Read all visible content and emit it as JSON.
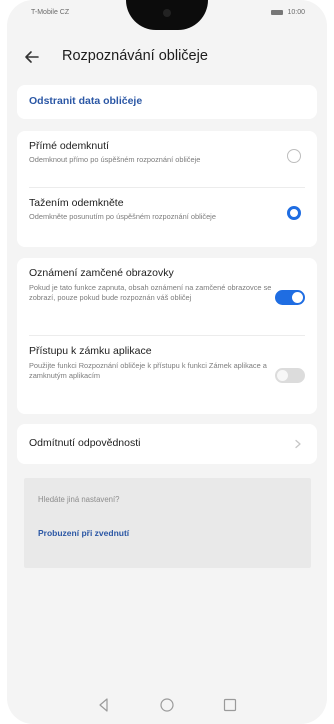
{
  "status": {
    "carrier": "T-Mobile CZ",
    "time": "10:00"
  },
  "header": {
    "title": "Rozpoznávání obličeje"
  },
  "remove_data": {
    "label": "Odstranit data obličeje"
  },
  "unlock_options": [
    {
      "title": "Přímé odemknutí",
      "desc": "Odemknout přímo po úspěšném rozpoznání obličeje",
      "selected": false
    },
    {
      "title": "Tažením odemkněte",
      "desc": "Odemkněte posunutím po úspěšném rozpoznání obličeje",
      "selected": true
    }
  ],
  "lock_screen_notifications": {
    "title": "Oznámení zamčené obrazovky",
    "desc": "Pokud je tato funkce zapnuta, obsah oznámení na zamčené obrazovce se zobrazí, pouze pokud bude rozpoznán váš obličej",
    "enabled": true
  },
  "app_lock_access": {
    "title": "Přístupu k zámku aplikace",
    "desc": "Použijte funkci Rozpoznání obličeje k přístupu k funkci Zámek aplikace a zamknutým aplikacím",
    "enabled": false
  },
  "disclaimer": {
    "label": "Odmítnutí odpovědnosti"
  },
  "suggestions": {
    "label": "Hledáte jiná nastavení?",
    "link": "Probuzení při zvednutí"
  },
  "colors": {
    "accent": "#1f6de2",
    "link": "#2b57a5",
    "background": "#f4f4f4"
  }
}
